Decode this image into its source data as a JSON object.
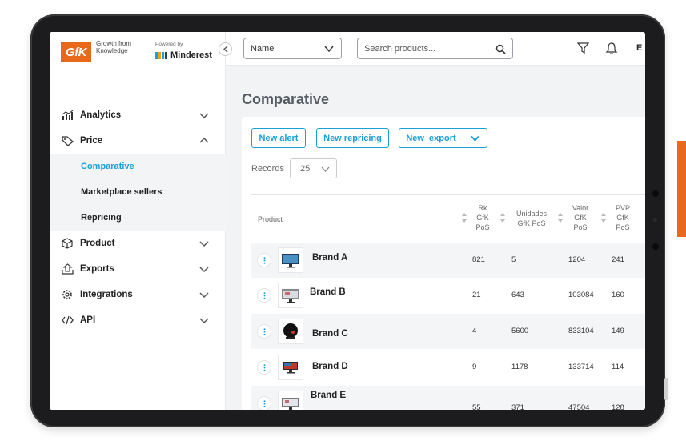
{
  "brand": {
    "logo_text": "GfK",
    "tagline": "Growth from Knowledge",
    "powered_by": "Powered by",
    "partner": "Minderest",
    "accent_color": "#e8691b",
    "link_color": "#1a9fd6"
  },
  "sidebar": {
    "items": [
      {
        "label": "Analytics",
        "icon": "chart-icon",
        "expanded": false
      },
      {
        "label": "Price",
        "icon": "tag-icon",
        "expanded": true,
        "children": [
          {
            "label": "Comparative",
            "active": true
          },
          {
            "label": "Marketplace sellers",
            "active": false
          },
          {
            "label": "Repricing",
            "active": false
          }
        ]
      },
      {
        "label": "Product",
        "icon": "cube-icon",
        "expanded": false
      },
      {
        "label": "Exports",
        "icon": "export-icon",
        "expanded": false
      },
      {
        "label": "Integrations",
        "icon": "gear-icon",
        "expanded": false
      },
      {
        "label": "API",
        "icon": "code-icon",
        "expanded": false
      }
    ]
  },
  "topbar": {
    "name_select": "Name",
    "search_placeholder": "Search products...",
    "user_initial": "E"
  },
  "page": {
    "title": "Comparative",
    "buttons": {
      "new_alert": "New alert",
      "new_repricing": "New repricing",
      "new_export": "New  export"
    },
    "records_label": "Records",
    "records_value": "25"
  },
  "table": {
    "headers": {
      "product": "Product",
      "rk": [
        "Rk",
        "GfK",
        "PoS"
      ],
      "unidades": [
        "Unidades",
        "GfK PoS"
      ],
      "valor": [
        "Valor",
        "GfK",
        "PoS"
      ],
      "pvp": [
        "PVP",
        "GfK",
        "PoS"
      ]
    },
    "rows": [
      {
        "brand": "Brand A",
        "rk": "821",
        "unidades": "5",
        "valor": "1204",
        "pvp": "241"
      },
      {
        "brand": "Brand B",
        "rk": "21",
        "unidades": "643",
        "valor": "103084",
        "pvp": "160"
      },
      {
        "brand": "Brand C",
        "rk": "4",
        "unidades": "5600",
        "valor": "833104",
        "pvp": "149"
      },
      {
        "brand": "Brand D",
        "rk": "9",
        "unidades": "1178",
        "valor": "133714",
        "pvp": "114"
      },
      {
        "brand": "Brand E",
        "rk": "55",
        "unidades": "371",
        "valor": "47504",
        "pvp": "128"
      }
    ]
  }
}
